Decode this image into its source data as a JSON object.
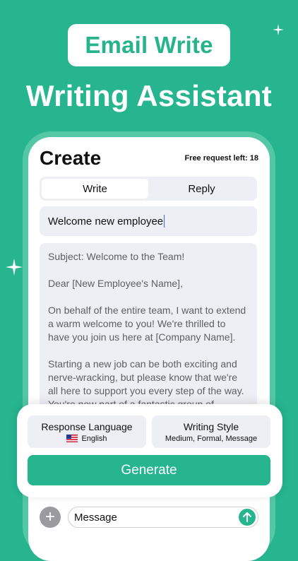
{
  "banner": {
    "brand": "Email Write",
    "headline": "Writing Assistant"
  },
  "header": {
    "title": "Create",
    "free_request_label": "Free request left: ",
    "free_request_count": "18"
  },
  "tabs": [
    {
      "label": "Write",
      "active": true
    },
    {
      "label": "Reply",
      "active": false
    }
  ],
  "prompt": {
    "value": "Welcome new employee"
  },
  "email": {
    "paragraphs": [
      "Subject: Welcome to the Team!",
      "Dear [New Employee's Name],",
      "On behalf of the entire team, I want to extend a warm welcome to you! We're thrilled to have you join us here at [Company Name].",
      "Starting a new job can be both exciting and nerve-wracking, but please know that we're all here to support you every step of the way. You're now part of a fantastic group of"
    ]
  },
  "options": {
    "language": {
      "title": "Response Language",
      "value": "English",
      "flag_icon": "us-flag-icon"
    },
    "style": {
      "title": "Writing Style",
      "value": "Medium, Formal, Message"
    }
  },
  "generate_label": "Generate",
  "composer": {
    "placeholder": "Message",
    "plus_icon": "plus-icon",
    "send_icon": "arrow-up-icon"
  },
  "colors": {
    "brand_green": "#26b58f",
    "field_bg": "#eeeff5"
  }
}
